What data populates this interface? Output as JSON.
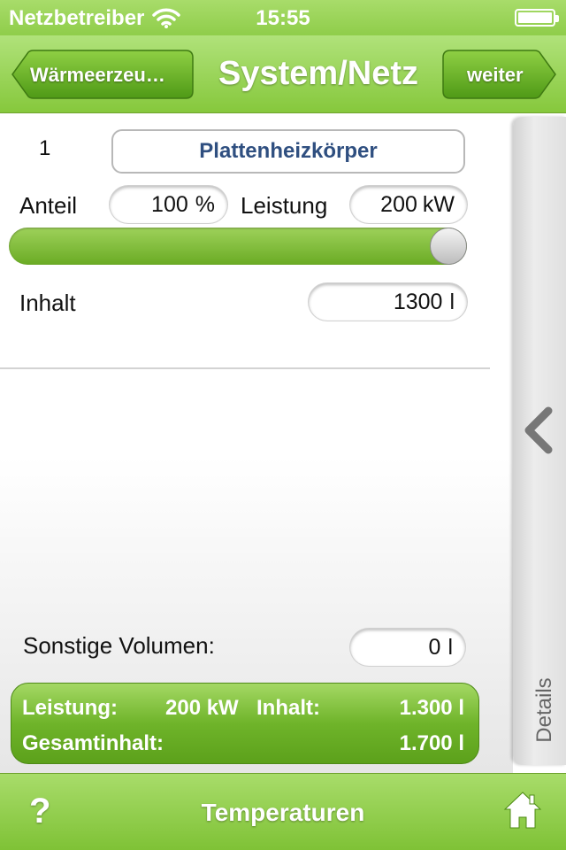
{
  "status": {
    "carrier": "Netzbetreiber",
    "time": "15:55"
  },
  "nav": {
    "back_label": "Wärmeerzeu…",
    "title": "System/Netz",
    "next_label": "weiter"
  },
  "item": {
    "number": "1",
    "type": "Plattenheizkörper",
    "anteil_label": "Anteil",
    "anteil_value": "100",
    "anteil_unit": "%",
    "leistung_label": "Leistung",
    "leistung_value": "200",
    "leistung_unit": "kW",
    "slider_fraction": 1.0,
    "inhalt_label": "Inhalt",
    "inhalt_value": "1300",
    "inhalt_unit": "l"
  },
  "sonstige": {
    "label": "Sonstige Volumen:",
    "value": "0",
    "unit": "l"
  },
  "summary": {
    "leistung_label": "Leistung:",
    "leistung_value": "200 kW",
    "inhalt_label": "Inhalt:",
    "inhalt_value": "1.300 l",
    "gesamt_label": "Gesamtinhalt:",
    "gesamt_value": "1.700 l"
  },
  "sidetab": {
    "label": "Details"
  },
  "toolbar": {
    "help": "?",
    "title": "Temperaturen"
  },
  "colors": {
    "accent_green": "#86c83c",
    "dark_green": "#5ca11b",
    "type_text": "#2f4f80"
  },
  "icons": {
    "wifi": "wifi-icon",
    "battery": "battery-icon",
    "chevron": "chevron-left-icon",
    "home": "home-icon"
  }
}
